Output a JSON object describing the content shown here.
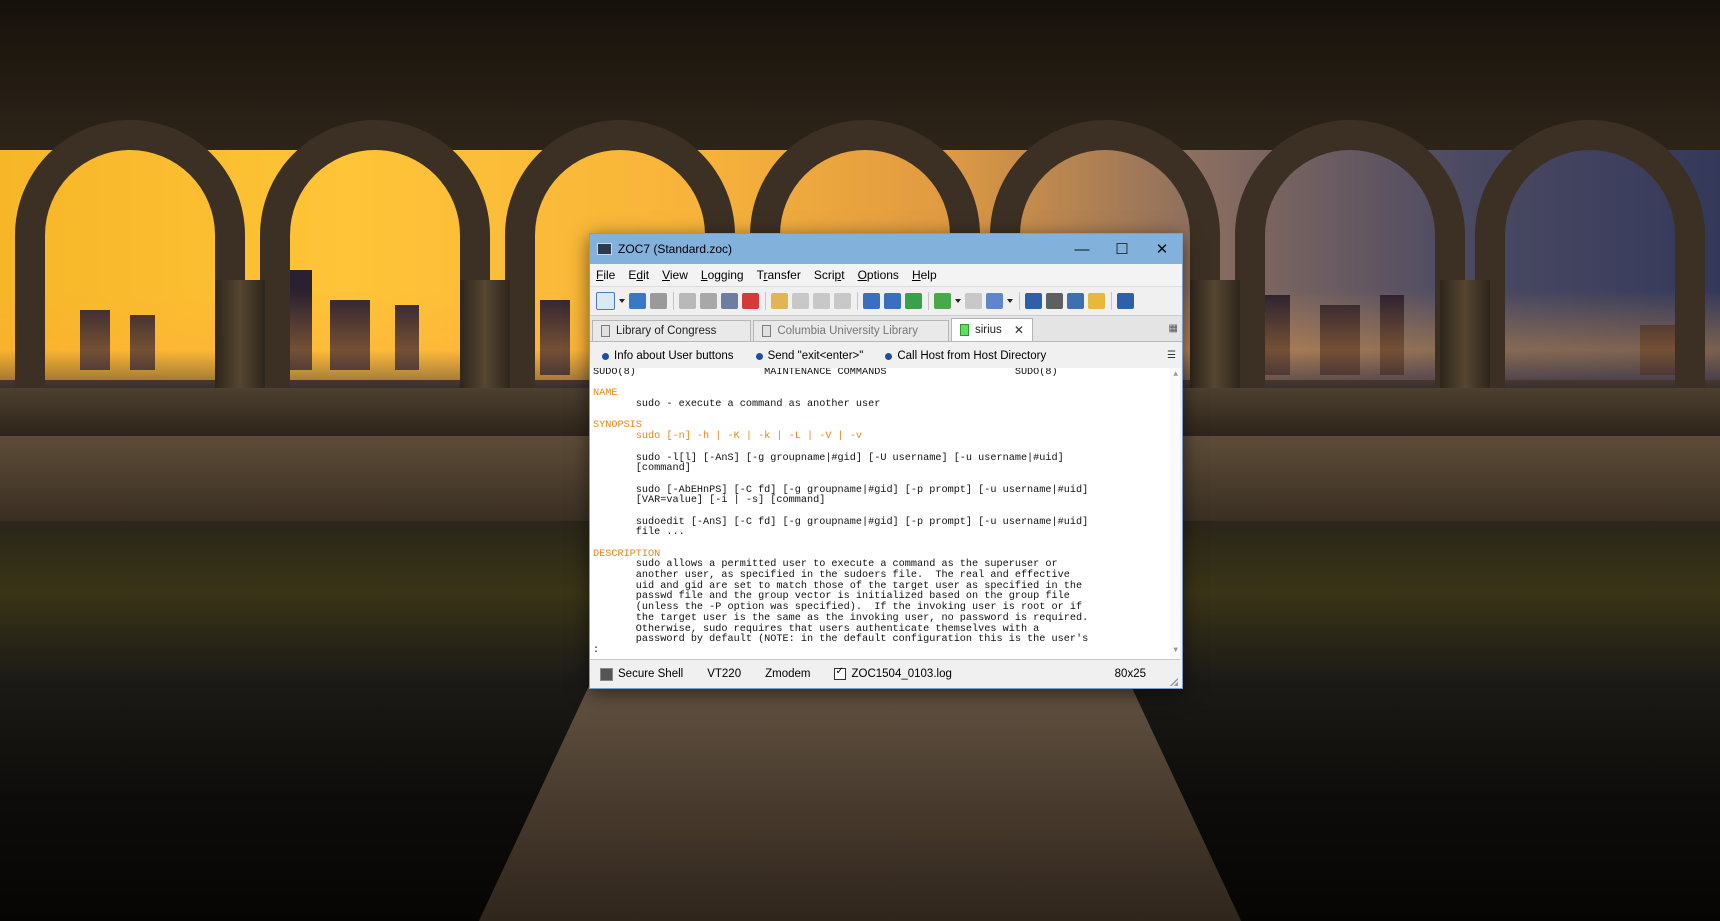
{
  "window": {
    "title": "ZOC7 (Standard.zoc)",
    "controls": {
      "minimize": "—",
      "maximize": "☐",
      "close": "✕"
    }
  },
  "menu": [
    {
      "pre": "",
      "key": "F",
      "post": "ile"
    },
    {
      "pre": "E",
      "key": "d",
      "post": "it"
    },
    {
      "pre": "",
      "key": "V",
      "post": "iew"
    },
    {
      "pre": "",
      "key": "L",
      "post": "ogging"
    },
    {
      "pre": "T",
      "key": "r",
      "post": "ansfer"
    },
    {
      "pre": "Scri",
      "key": "p",
      "post": "t"
    },
    {
      "pre": "",
      "key": "O",
      "post": "ptions"
    },
    {
      "pre": "",
      "key": "H",
      "post": "elp"
    }
  ],
  "tabs": [
    {
      "label": "Library of Congress",
      "state": "inactive"
    },
    {
      "label": "Columbia University Library",
      "state": "dim"
    },
    {
      "label": "sirius",
      "state": "active",
      "close": "✕"
    }
  ],
  "user_buttons": [
    {
      "label": "Info about User buttons"
    },
    {
      "label": "Send \"exit<enter>\""
    },
    {
      "label": "Call Host from Host Directory"
    }
  ],
  "terminal": {
    "header": "SUDO(8)                     MAINTENANCE COMMANDS                     SUDO(8)",
    "name_heading": "NAME",
    "name_body": "       sudo - execute a command as another user",
    "synopsis_heading": "SYNOPSIS",
    "syn1": "       sudo [-n] -h | -K | -k | -L | -V | -v",
    "syn2a": "       sudo -l[l] [-AnS] [-g groupname|#gid] [-U username] [-u username|#uid]",
    "syn2b": "       [command]",
    "syn3a": "       sudo [-AbEHnPS] [-C fd] [-g groupname|#gid] [-p prompt] [-u username|#uid]",
    "syn3b": "       [VAR=value] [-i | -s] [command]",
    "syn4a": "       sudoedit [-AnS] [-C fd] [-g groupname|#gid] [-p prompt] [-u username|#uid]",
    "syn4b": "       file ...",
    "description_heading": "DESCRIPTION",
    "d1": "       sudo allows a permitted user to execute a command as the superuser or",
    "d2": "       another user, as specified in the sudoers file.  The real and effective",
    "d3": "       uid and gid are set to match those of the target user as specified in the",
    "d4": "       passwd file and the group vector is initialized based on the group file",
    "d5": "       (unless the -P option was specified).  If the invoking user is root or if",
    "d6": "       the target user is the same as the invoking user, no password is required.",
    "d7": "       Otherwise, sudo requires that users authenticate themselves with a",
    "d8": "       password by default (NOTE: in the default configuration this is the user's",
    "prompt": ":"
  },
  "status": {
    "connection": "Secure Shell",
    "emulation": "VT220",
    "transfer": "Zmodem",
    "logfile": "ZOC1504_0103.log",
    "size": "80x25"
  },
  "colors": {
    "titlebar": "#82b1db",
    "highlight": "#e8861a",
    "bullet": "#1d4fa0",
    "active_tab_indicator": "#5ee05e"
  }
}
